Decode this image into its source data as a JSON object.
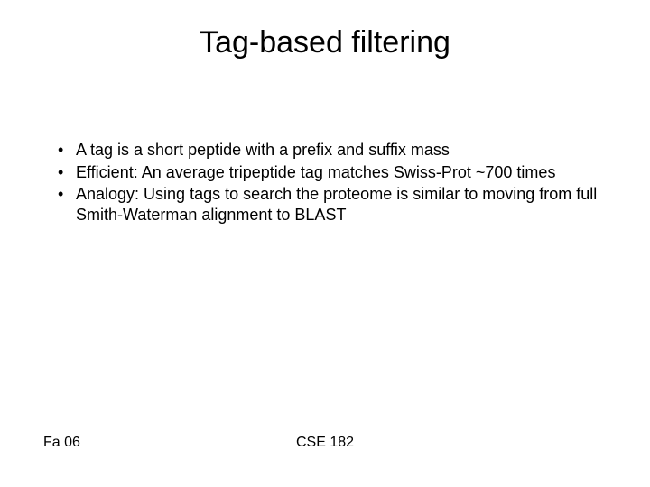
{
  "title": "Tag-based filtering",
  "bullets": [
    "A tag is a short peptide with a prefix and suffix mass",
    "Efficient: An average tripeptide tag matches Swiss-Prot ~700 times",
    "Analogy: Using tags to search the proteome is similar to moving from full Smith-Waterman alignment to BLAST"
  ],
  "footer": {
    "left": "Fa 06",
    "center": "CSE 182"
  }
}
